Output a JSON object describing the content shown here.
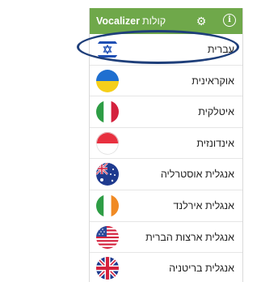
{
  "appbar": {
    "brand": "Vocalizer",
    "title_rest": "קולות",
    "settings_icon": "gear-icon",
    "info_icon": "info-icon",
    "info_glyph": "i",
    "color": "#6fa84a"
  },
  "languages": [
    {
      "label": "עברית",
      "flag": "israel-flag-icon",
      "selected": true
    },
    {
      "label": "אוקראינית",
      "flag": "ukraine-flag-icon"
    },
    {
      "label": "איטלקית",
      "flag": "italy-flag-icon"
    },
    {
      "label": "אינדונזית",
      "flag": "indonesia-flag-icon"
    },
    {
      "label": "אנגלית אוסטרליה",
      "flag": "australia-flag-icon"
    },
    {
      "label": "אנגלית אירלנד",
      "flag": "ireland-flag-icon"
    },
    {
      "label": "אנגלית ארצות הברית",
      "flag": "usa-flag-icon"
    },
    {
      "label": "אנגלית בריטניה",
      "flag": "uk-flag-icon"
    }
  ],
  "highlight_color": "#1f3f7a"
}
